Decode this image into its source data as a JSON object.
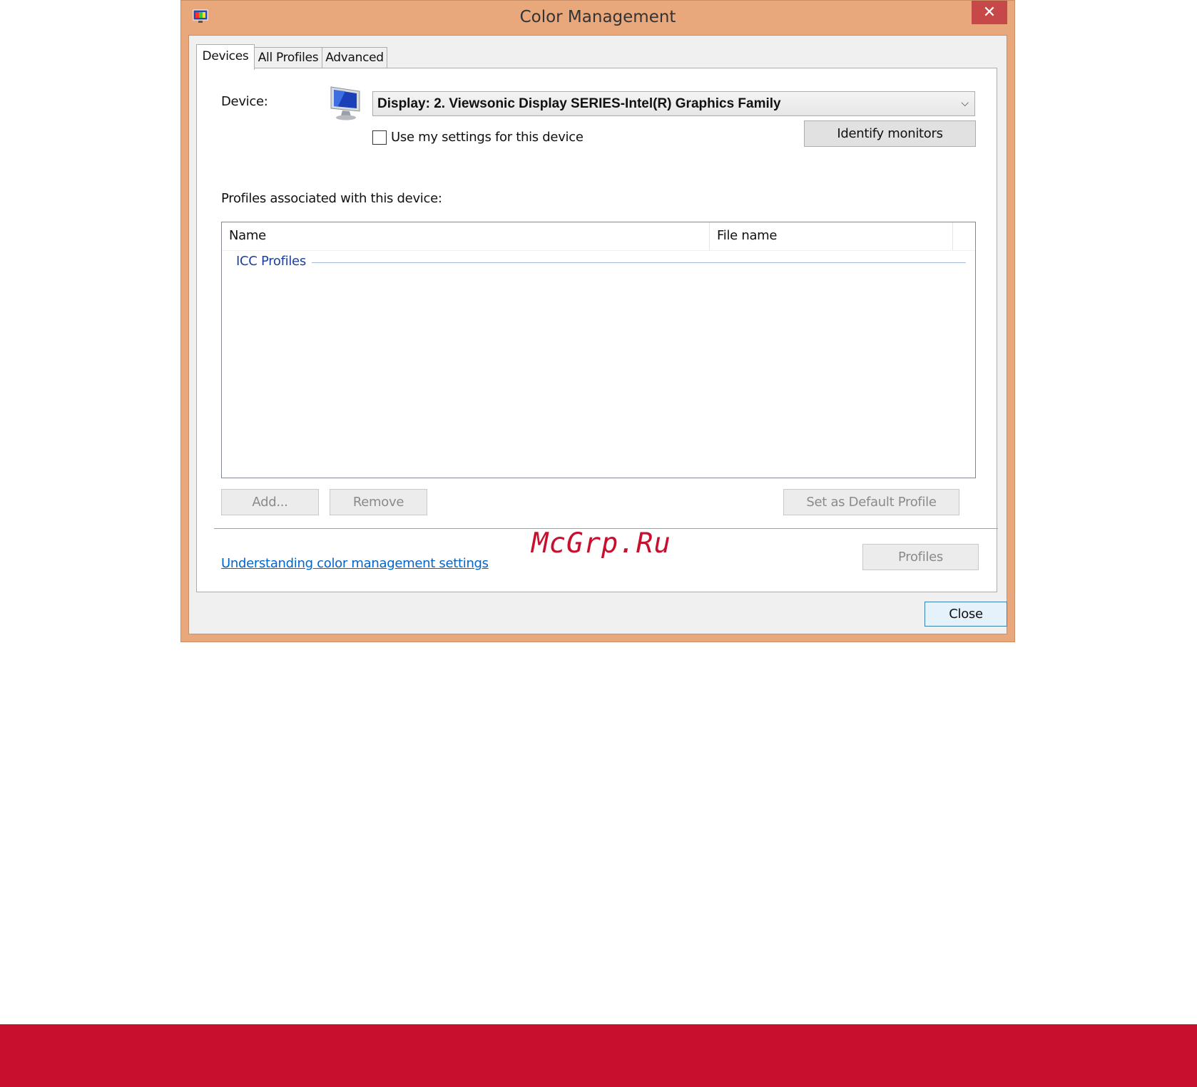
{
  "window": {
    "title": "Color Management",
    "close_glyph": "✕",
    "icon": "color-management-icon"
  },
  "tabs": [
    {
      "label": "Devices",
      "active": true
    },
    {
      "label": "All Profiles",
      "active": false
    },
    {
      "label": "Advanced",
      "active": false
    }
  ],
  "devices": {
    "device_label": "Device:",
    "device_icon": "monitor-icon",
    "device_value": "Display: 2. Viewsonic Display SERIES-Intel(R) Graphics Family",
    "use_my_settings_label": "Use my settings for this device",
    "use_my_settings_checked": false,
    "identify_monitors_label": "Identify monitors",
    "profiles_label": "Profiles associated with this device:",
    "columns": [
      "Name",
      "File name"
    ],
    "group_label": "ICC Profiles",
    "add_label": "Add...",
    "remove_label": "Remove",
    "set_default_label": "Set as Default Profile",
    "link_label": "Understanding color management settings",
    "profiles_button_label": "Profiles"
  },
  "close_label": "Close",
  "watermark": "McGrp.Ru",
  "colors": {
    "window_frame": "#e8a87c",
    "close_button": "#c74848",
    "link": "#0066cc",
    "group_label": "#1e3fa0",
    "footer_bar": "#c8102e",
    "watermark": "#c8102e"
  }
}
